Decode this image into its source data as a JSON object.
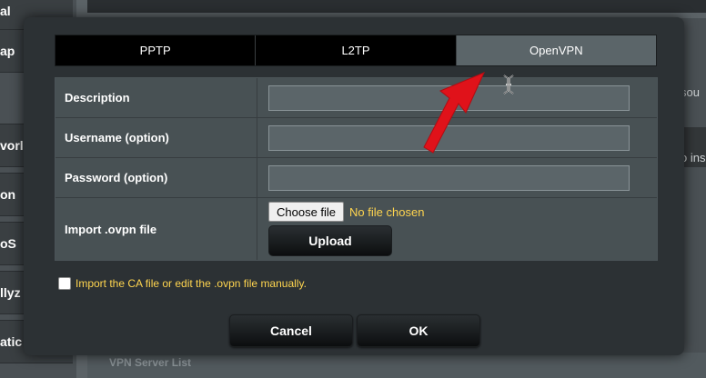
{
  "background": {
    "left_nav": [
      "al",
      "ap",
      "",
      "vorl",
      "on",
      "oS",
      "llyz",
      "atic"
    ],
    "right_texts": [
      "sou",
      "o ins"
    ],
    "bottom_section": "VPN Server List"
  },
  "tabs": [
    {
      "label": "PPTP",
      "active": false
    },
    {
      "label": "L2TP",
      "active": false
    },
    {
      "label": "OpenVPN",
      "active": true
    }
  ],
  "form": {
    "description_label": "Description",
    "description_value": "",
    "username_label": "Username (option)",
    "username_value": "",
    "password_label": "Password (option)",
    "password_value": "",
    "import_label": "Import .ovpn file",
    "choose_file_label": "Choose file",
    "no_file_text": "No file chosen",
    "upload_label": "Upload"
  },
  "ca_option_text": "Import the CA file or edit the .ovpn file manually.",
  "buttons": {
    "cancel": "Cancel",
    "ok": "OK"
  },
  "colors": {
    "accent_text": "#ffd54f",
    "annotation_arrow": "#e0121a",
    "modal_background": "#2c3134",
    "active_tab": "#5b6569"
  },
  "icons": {
    "cursor": "text-cursor-icon",
    "arrow": "red-arrow-annotation"
  }
}
